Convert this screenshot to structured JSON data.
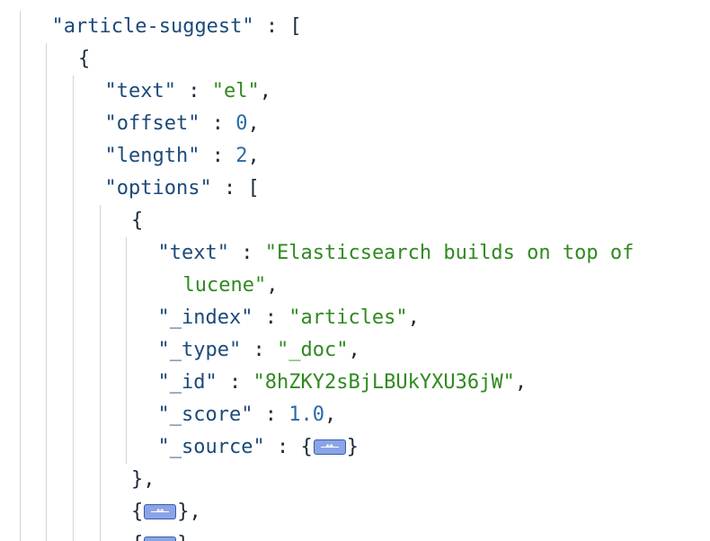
{
  "lines": [
    {
      "depth": 1,
      "tokens": [
        {
          "t": "\"article-suggest\"",
          "c": "k"
        },
        {
          "t": " : [",
          "c": "p"
        }
      ]
    },
    {
      "depth": 2,
      "tokens": [
        {
          "t": "{",
          "c": "p"
        }
      ]
    },
    {
      "depth": 3,
      "tokens": [
        {
          "t": "\"text\"",
          "c": "k"
        },
        {
          "t": " : ",
          "c": "p"
        },
        {
          "t": "\"el\"",
          "c": "s"
        },
        {
          "t": ",",
          "c": "p"
        }
      ]
    },
    {
      "depth": 3,
      "tokens": [
        {
          "t": "\"offset\"",
          "c": "k"
        },
        {
          "t": " : ",
          "c": "p"
        },
        {
          "t": "0",
          "c": "n"
        },
        {
          "t": ",",
          "c": "p"
        }
      ]
    },
    {
      "depth": 3,
      "tokens": [
        {
          "t": "\"length\"",
          "c": "k"
        },
        {
          "t": " : ",
          "c": "p"
        },
        {
          "t": "2",
          "c": "n"
        },
        {
          "t": ",",
          "c": "p"
        }
      ]
    },
    {
      "depth": 3,
      "tokens": [
        {
          "t": "\"options\"",
          "c": "k"
        },
        {
          "t": " : [",
          "c": "p"
        }
      ]
    },
    {
      "depth": 4,
      "tokens": [
        {
          "t": "{",
          "c": "p"
        }
      ]
    },
    {
      "depth": 5,
      "tokens": [
        {
          "t": "\"text\"",
          "c": "k"
        },
        {
          "t": " : ",
          "c": "p"
        },
        {
          "t": "\"Elasticsearch builds on top of",
          "c": "s"
        }
      ]
    },
    {
      "depth": 5,
      "wrap": true,
      "tokens": [
        {
          "t": "lucene\"",
          "c": "s"
        },
        {
          "t": ",",
          "c": "p"
        }
      ]
    },
    {
      "depth": 5,
      "tokens": [
        {
          "t": "\"_index\"",
          "c": "k"
        },
        {
          "t": " : ",
          "c": "p"
        },
        {
          "t": "\"articles\"",
          "c": "s"
        },
        {
          "t": ",",
          "c": "p"
        }
      ]
    },
    {
      "depth": 5,
      "tokens": [
        {
          "t": "\"_type\"",
          "c": "k"
        },
        {
          "t": " : ",
          "c": "p"
        },
        {
          "t": "\"_doc\"",
          "c": "s"
        },
        {
          "t": ",",
          "c": "p"
        }
      ]
    },
    {
      "depth": 5,
      "tokens": [
        {
          "t": "\"_id\"",
          "c": "k"
        },
        {
          "t": " : ",
          "c": "p"
        },
        {
          "t": "\"8hZKY2sBjLBUkYXU36jW\"",
          "c": "s"
        },
        {
          "t": ",",
          "c": "p"
        }
      ]
    },
    {
      "depth": 5,
      "tokens": [
        {
          "t": "\"_score\"",
          "c": "k"
        },
        {
          "t": " : ",
          "c": "p"
        },
        {
          "t": "1.0",
          "c": "n"
        },
        {
          "t": ",",
          "c": "p"
        }
      ]
    },
    {
      "depth": 5,
      "tokens": [
        {
          "t": "\"_source\"",
          "c": "k"
        },
        {
          "t": " : {",
          "c": "p"
        },
        {
          "fold": true
        },
        {
          "t": "}",
          "c": "p"
        }
      ]
    },
    {
      "depth": 4,
      "tokens": [
        {
          "t": "},",
          "c": "p"
        }
      ]
    },
    {
      "depth": 4,
      "tokens": [
        {
          "t": "{",
          "c": "p"
        },
        {
          "fold": true
        },
        {
          "t": "},",
          "c": "p"
        }
      ]
    },
    {
      "depth": 4,
      "tokens": [
        {
          "t": "{",
          "c": "p"
        },
        {
          "fold": true
        },
        {
          "t": "},",
          "c": "p"
        }
      ]
    }
  ],
  "colors": {
    "key": "#1c4a7a",
    "string": "#2f8a1f",
    "number": "#2a6aa8",
    "punct": "#1a2a3a",
    "guide": "#d4d4d4",
    "fold_bg": "#8aa4e6",
    "fold_border": "#3b5bb0"
  }
}
